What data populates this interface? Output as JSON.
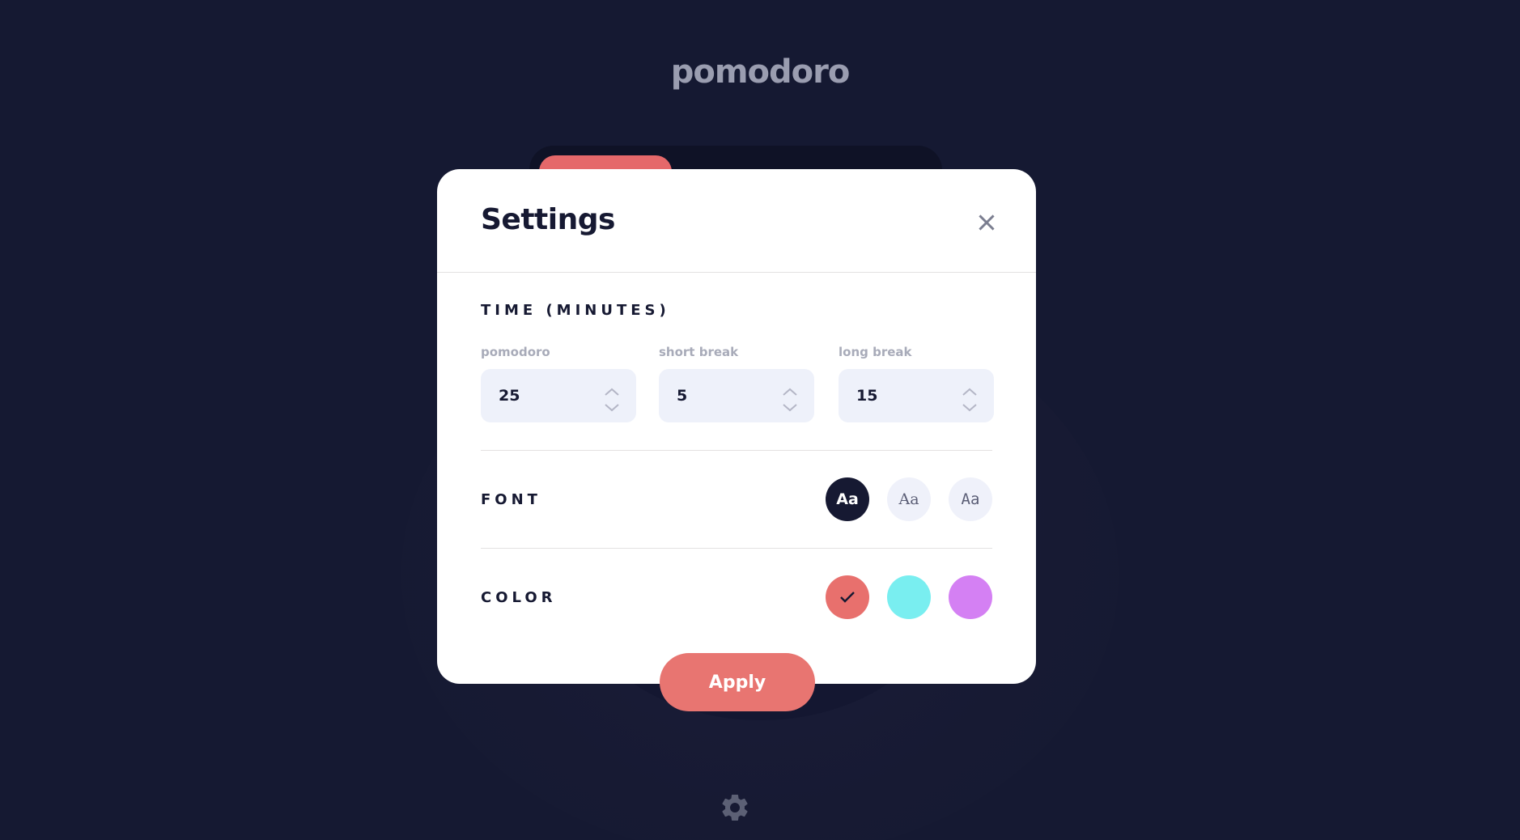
{
  "app": {
    "title": "pomodoro"
  },
  "settings": {
    "title": "Settings",
    "time_section": "TIME (MINUTES)",
    "fields": [
      {
        "label": "pomodoro",
        "value": "25"
      },
      {
        "label": "short break",
        "value": "5"
      },
      {
        "label": "long break",
        "value": "15"
      }
    ],
    "font_section": "FONT",
    "fonts": [
      {
        "label": "Aa",
        "selected": true
      },
      {
        "label": "Aa",
        "selected": false
      },
      {
        "label": "Aa",
        "selected": false
      }
    ],
    "color_section": "COLOR",
    "colors": [
      {
        "hex": "#e8706d",
        "selected": true
      },
      {
        "hex": "#79eef0",
        "selected": false
      },
      {
        "hex": "#d480f3",
        "selected": false
      }
    ],
    "apply_label": "Apply"
  },
  "theme": {
    "background": "#151932",
    "accent": "#e87571",
    "text": "#161932"
  },
  "icons": {
    "close": "close-icon",
    "settings": "gear-icon",
    "check": "check-icon",
    "up": "chevron-up-icon",
    "down": "chevron-down-icon"
  }
}
